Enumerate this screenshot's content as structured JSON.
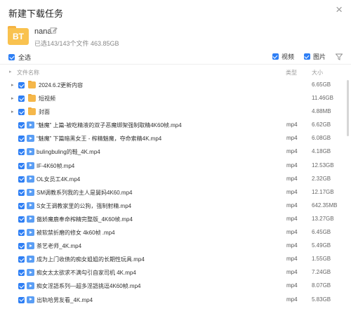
{
  "window": {
    "title": "新建下载任务",
    "close_glyph": "×"
  },
  "task": {
    "icon_text": "BT",
    "name": "nana",
    "summary": "已选143/143个文件 463.85GB"
  },
  "toolbar": {
    "select_all_label": "全选",
    "filter_video_label": "视频",
    "filter_image_label": "图片"
  },
  "columns": {
    "name": "文件名称",
    "type": "类型",
    "size": "大小"
  },
  "rows": [
    {
      "kind": "folder",
      "name": "2024.6.2更新内容",
      "type": "",
      "size": "6.65GB"
    },
    {
      "kind": "folder",
      "name": "短视频",
      "type": "",
      "size": "11.46GB"
    },
    {
      "kind": "folder",
      "name": "封面",
      "type": "",
      "size": "4.88MB"
    },
    {
      "kind": "video",
      "name": "“魅魔” 上篇-被吃精液的双子恶魔绑架强制取精4K60帧.mp4",
      "type": "mp4",
      "size": "6.62GB"
    },
    {
      "kind": "video",
      "name": "“魅魔” 下篇暗黑女王 - 榨精魅魔，夺命索精4K.mp4",
      "type": "mp4",
      "size": "6.08GB"
    },
    {
      "kind": "video",
      "name": "bulingbuling的鞋_4K.mp4",
      "type": "mp4",
      "size": "4.18GB"
    },
    {
      "kind": "video",
      "name": "IF-4K60帧.mp4",
      "type": "mp4",
      "size": "12.53GB"
    },
    {
      "kind": "video",
      "name": "OL女员工4K.mp4",
      "type": "mp4",
      "size": "2.32GB"
    },
    {
      "kind": "video",
      "name": "SM调教系列我的主人是舅妈4K60.mp4",
      "type": "mp4",
      "size": "12.17GB"
    },
    {
      "kind": "video",
      "name": "S女王调教家里的公狗，强制射精.mp4",
      "type": "mp4",
      "size": "642.35MB"
    },
    {
      "kind": "video",
      "name": "傲娇魔鹿奉命榨精完整版_4K60帧.mp4",
      "type": "mp4",
      "size": "13.27GB"
    },
    {
      "kind": "video",
      "name": "被软禁折磨的修女 4k60帧 .mp4",
      "type": "mp4",
      "size": "6.45GB"
    },
    {
      "kind": "video",
      "name": "茶艺老师_4K.mp4",
      "type": "mp4",
      "size": "5.49GB"
    },
    {
      "kind": "video",
      "name": "成为上门收债的痴女姐姐的长期性玩具.mp4",
      "type": "mp4",
      "size": "1.55GB"
    },
    {
      "kind": "video",
      "name": "痴女太太欲求不满勾引自家司机 4K.mp4",
      "type": "mp4",
      "size": "7.24GB"
    },
    {
      "kind": "video",
      "name": "痴女淫語系列—超多淫語挑逗4K60帧.mp4",
      "type": "mp4",
      "size": "8.07GB"
    },
    {
      "kind": "video",
      "name": "出轨哈男友看_4K.mp4",
      "type": "mp4",
      "size": "5.83GB"
    }
  ],
  "colors": {
    "accent": "#2e7ff5",
    "folder": "#f5b74a",
    "video": "#5a9ef5",
    "bt": "#f9c24f"
  },
  "icons": {
    "close": "close-icon",
    "edit": "edit-icon",
    "filter": "funnel-icon",
    "folder": "folder-icon",
    "video": "video-file-icon"
  }
}
